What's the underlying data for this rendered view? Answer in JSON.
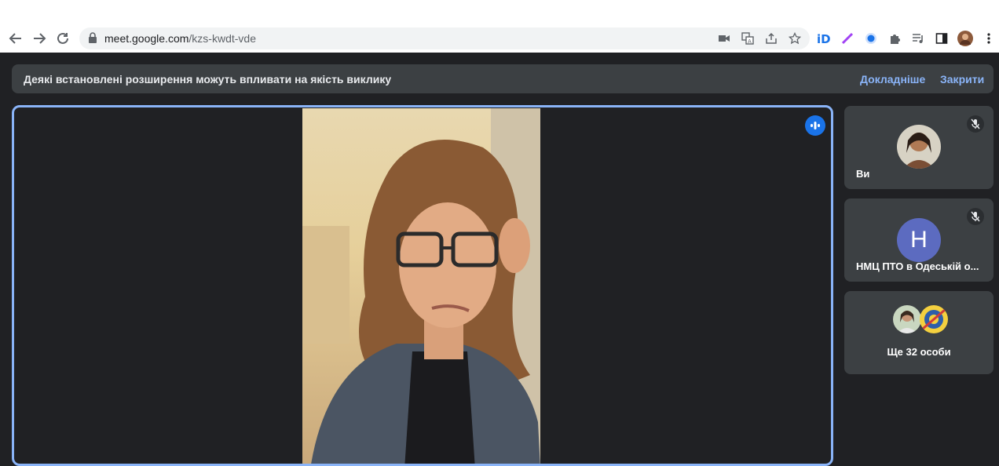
{
  "browser": {
    "url_host": "meet.google.com",
    "url_path": "/kzs-kwdt-vde"
  },
  "banner": {
    "message": "Деякі встановлені розширення можуть впливати на якість виклику",
    "learn_more": "Докладніше",
    "close": "Закрити"
  },
  "participants": {
    "self_name": "Ви",
    "second_name": "НМЦ ПТО в Одеській о...",
    "second_initial": "Н",
    "more_label": "Ще 32 особи"
  },
  "colors": {
    "accent": "#8ab4f8",
    "speaking": "#1a73e8",
    "tile": "#3c4043",
    "background": "#202124"
  }
}
